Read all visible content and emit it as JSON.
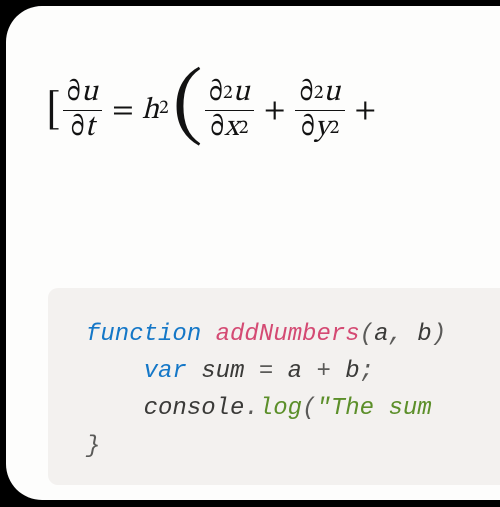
{
  "math": {
    "lbracket": "[",
    "frac1_num_d": "∂",
    "frac1_num_var": "u",
    "frac1_den_d": "∂",
    "frac1_den_var": "t",
    "eq": "=",
    "h": "h",
    "h_sup": "2",
    "lparen": "(",
    "frac2_num_d": "∂",
    "frac2_num_sup": "2",
    "frac2_num_var": "u",
    "frac2_den_d": "∂",
    "frac2_den_var": "x",
    "frac2_den_sup": "2",
    "plus1": "+",
    "frac3_num_d": "∂",
    "frac3_num_sup": "2",
    "frac3_num_var": "u",
    "frac3_den_d": "∂",
    "frac3_den_var": "y",
    "frac3_den_sup": "2",
    "plus2": "+"
  },
  "code": {
    "kw_function": "function",
    "sp": " ",
    "funcname": "addNumbers",
    "lparen": "(",
    "param_a": "a",
    "comma": ",",
    "param_b": "b",
    "rparen_frag": ")",
    "indent": "    ",
    "kw_var": "var",
    "var_sum": "sum",
    "eq": "=",
    "ident_a": "a",
    "plus": "+",
    "ident_b": "b",
    "semi": ";",
    "obj_console": "console",
    "dot": ".",
    "method_log": "log",
    "call_lparen": "(",
    "str_start": "\"The sum ",
    "rbrace_frag": "}"
  }
}
